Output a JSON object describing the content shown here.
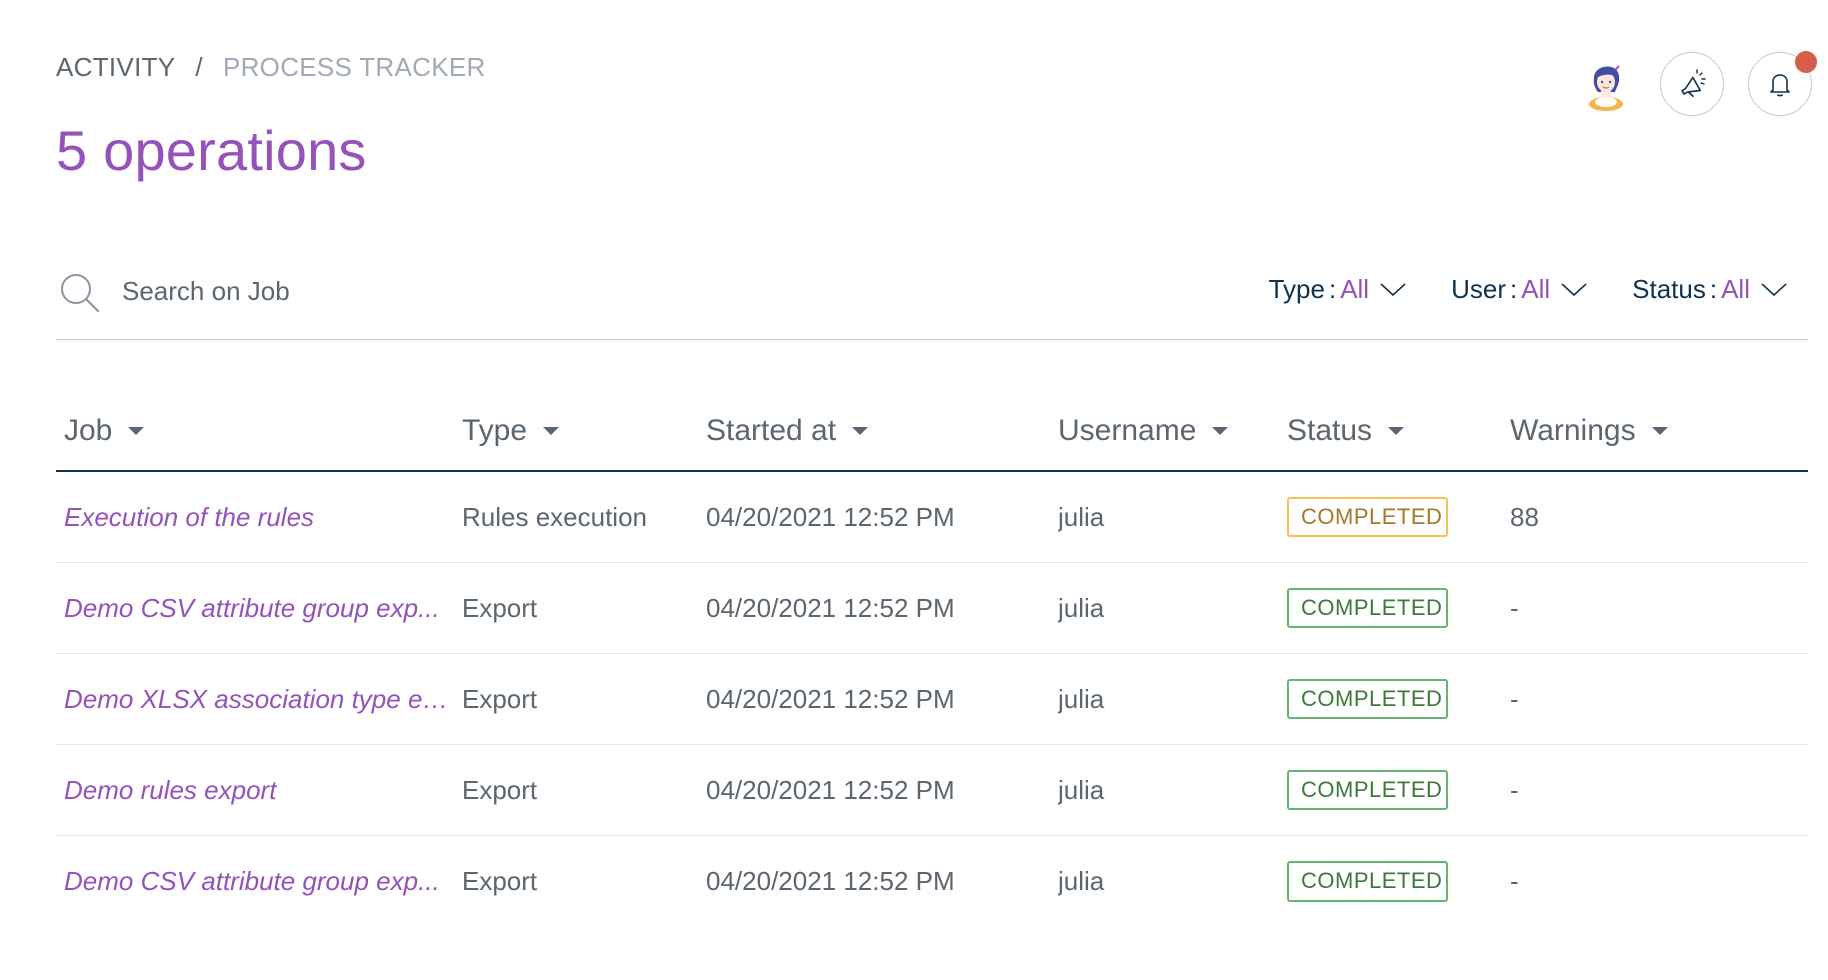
{
  "breadcrumb": {
    "items": [
      "ACTIVITY",
      "PROCESS TRACKER"
    ],
    "separator": "/"
  },
  "page_title": "5 operations",
  "header_icons": {
    "avatar": "user-avatar-illustration",
    "announcements": "megaphone-icon",
    "notifications": "bell-icon"
  },
  "search": {
    "placeholder": "Search on Job",
    "value": ""
  },
  "filters": [
    {
      "label": "Type",
      "value": "All"
    },
    {
      "label": "User",
      "value": "All"
    },
    {
      "label": "Status",
      "value": "All"
    }
  ],
  "table": {
    "columns": [
      "Job",
      "Type",
      "Started at",
      "Username",
      "Status",
      "Warnings"
    ],
    "rows": [
      {
        "job": "Execution of the rules",
        "type": "Rules execution",
        "started_at": "04/20/2021 12:52 PM",
        "username": "julia",
        "status": "COMPLETED",
        "status_variant": "warning",
        "warnings": "88"
      },
      {
        "job": "Demo CSV attribute group exp...",
        "type": "Export",
        "started_at": "04/20/2021 12:52 PM",
        "username": "julia",
        "status": "COMPLETED",
        "status_variant": "success",
        "warnings": "-"
      },
      {
        "job": "Demo XLSX association type ex...",
        "type": "Export",
        "started_at": "04/20/2021 12:52 PM",
        "username": "julia",
        "status": "COMPLETED",
        "status_variant": "success",
        "warnings": "-"
      },
      {
        "job": "Demo rules export",
        "type": "Export",
        "started_at": "04/20/2021 12:52 PM",
        "username": "julia",
        "status": "COMPLETED",
        "status_variant": "success",
        "warnings": "-"
      },
      {
        "job": "Demo CSV attribute group exp...",
        "type": "Export",
        "started_at": "04/20/2021 12:52 PM",
        "username": "julia",
        "status": "COMPLETED",
        "status_variant": "success",
        "warnings": "-"
      }
    ]
  },
  "colors": {
    "accent": "#9452ba",
    "text_dark": "#11324d",
    "text_muted": "#5b6670",
    "badge_warning": "#f3c155",
    "badge_success": "#67b373",
    "notification_dot": "#d4604a"
  }
}
